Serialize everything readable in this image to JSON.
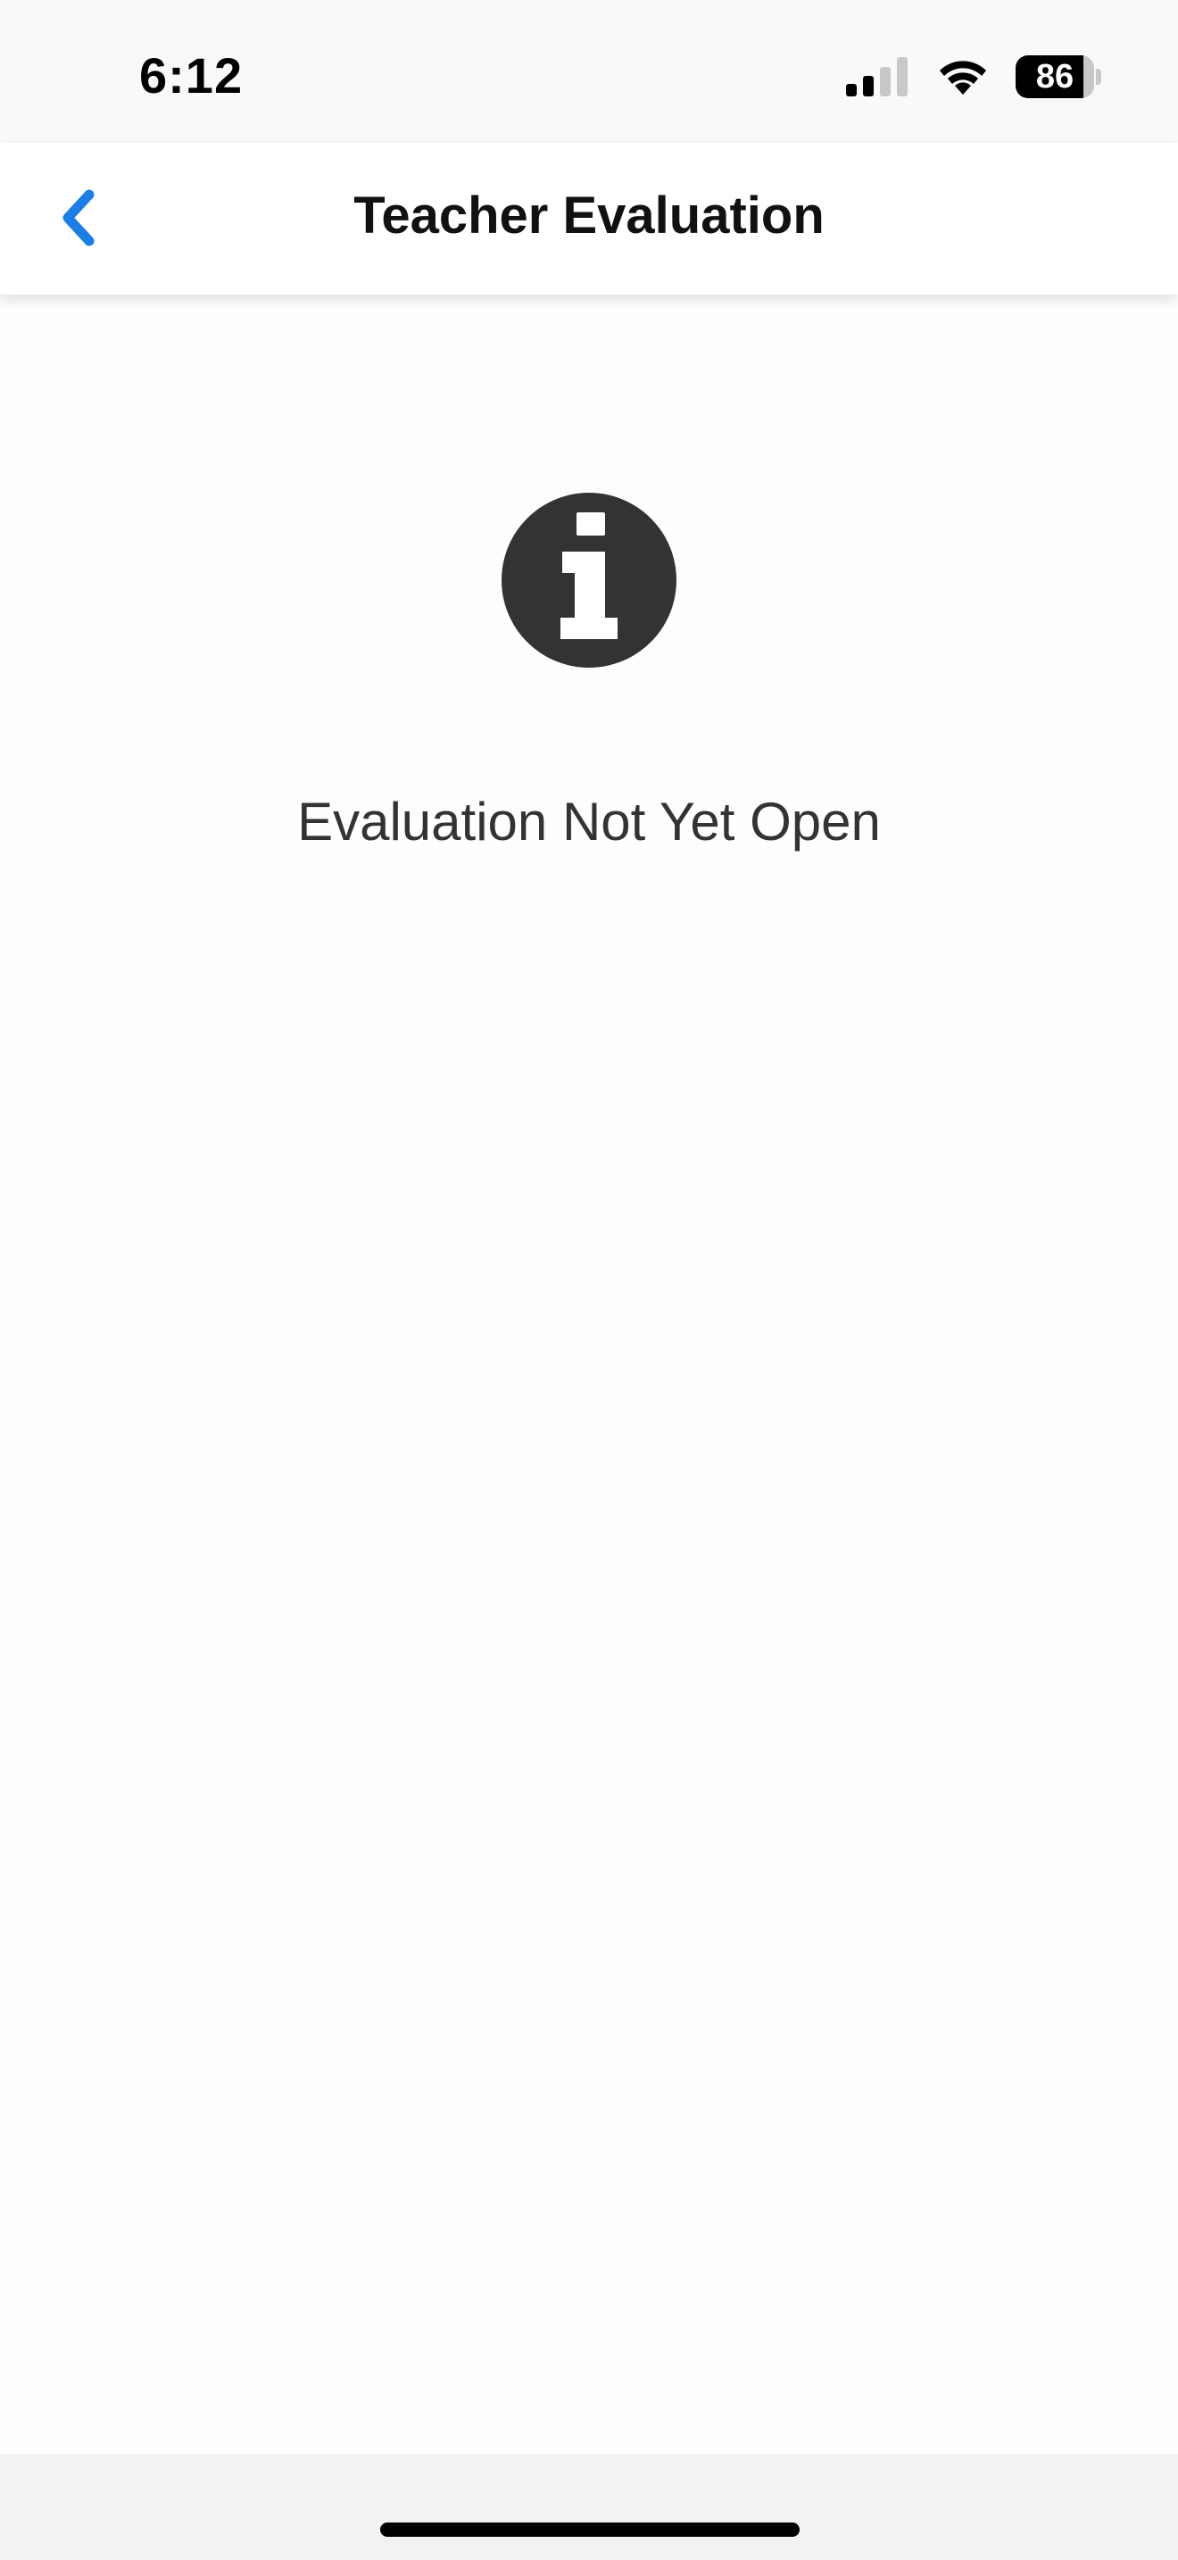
{
  "status_bar": {
    "time": "6:12",
    "battery_level": "86",
    "battery_fraction": 0.86,
    "signal_icon": "cellular-signal-icon",
    "wifi_icon": "wifi-icon"
  },
  "nav": {
    "title": "Teacher Evaluation",
    "back_icon": "chevron-left-icon",
    "accent_color": "#1a7ee6"
  },
  "main": {
    "icon": "info-icon",
    "icon_color": "#333333",
    "message": "Evaluation Not Yet Open"
  }
}
